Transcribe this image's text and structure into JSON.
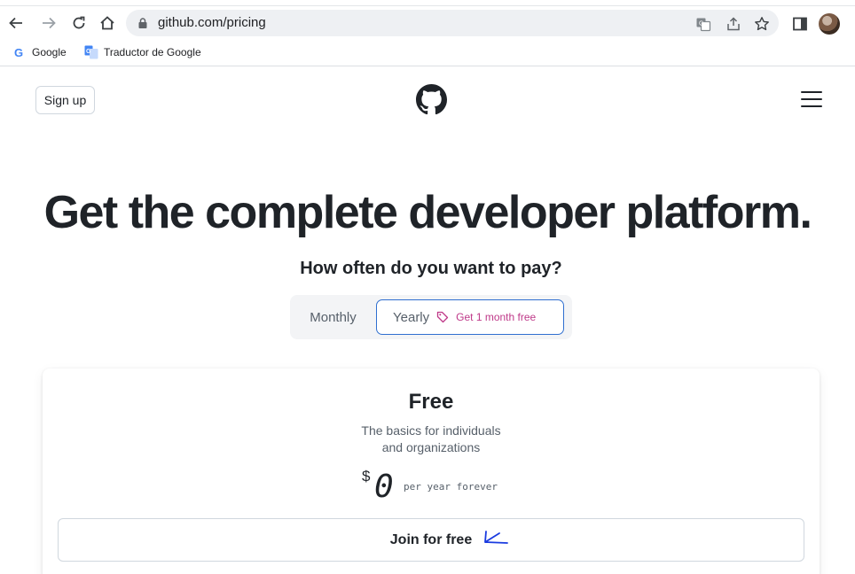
{
  "browser": {
    "url": "github.com/pricing",
    "bookmarks": [
      {
        "label": "Google",
        "icon": "google-g-icon"
      },
      {
        "label": "Traductor de Google",
        "icon": "google-translate-icon"
      }
    ]
  },
  "header": {
    "signup_label": "Sign up",
    "logo": "github-octocat-icon",
    "menu_icon": "hamburger-menu-icon"
  },
  "hero": {
    "title": "Get the complete developer platform.",
    "question": "How often do you want to pay?"
  },
  "billing_toggle": {
    "monthly_label": "Monthly",
    "yearly_label": "Yearly",
    "yearly_promo": "Get 1 month free",
    "selected": "Yearly"
  },
  "plan": {
    "name": "Free",
    "description_line1": "The basics for individuals",
    "description_line2": "and organizations",
    "currency": "$",
    "price": "0",
    "period": "per year forever",
    "cta_label": "Join for free"
  },
  "colors": {
    "accent_blue": "#2f6fd0",
    "promo_pink": "#bf3989",
    "text_dark": "#1f2328",
    "text_muted": "#57606a"
  }
}
